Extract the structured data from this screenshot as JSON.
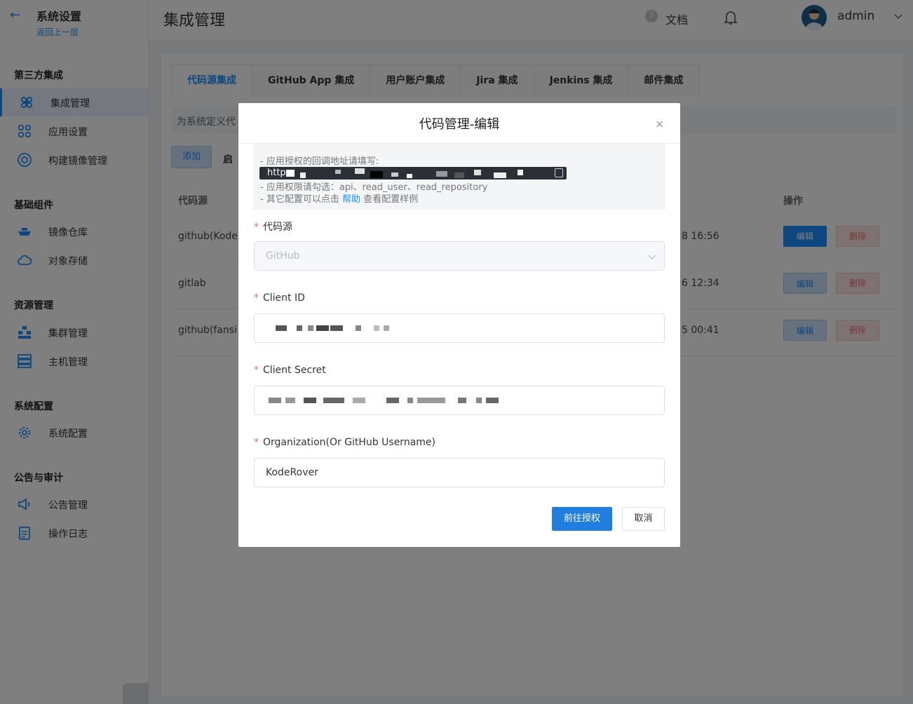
{
  "sidebar": {
    "title": "系统设置",
    "back_label": "返回上一层",
    "groups": [
      {
        "label": "第三方集成"
      },
      {
        "label": "基础组件"
      },
      {
        "label": "资源管理"
      },
      {
        "label": "系统配置"
      },
      {
        "label": "公告与审计"
      }
    ],
    "items": [
      {
        "label": "集成管理",
        "icon": "command-icon",
        "active": true
      },
      {
        "label": "应用设置",
        "icon": "apps-icon"
      },
      {
        "label": "构建镜像管理",
        "icon": "disc-icon"
      },
      {
        "label": "镜像仓库",
        "icon": "ship-icon"
      },
      {
        "label": "对象存储",
        "icon": "cloud-icon"
      },
      {
        "label": "集群管理",
        "icon": "cluster-icon"
      },
      {
        "label": "主机管理",
        "icon": "server-icon"
      },
      {
        "label": "系统配置",
        "icon": "gear-icon"
      },
      {
        "label": "公告管理",
        "icon": "megaphone-icon"
      },
      {
        "label": "操作日志",
        "icon": "clipboard-icon"
      }
    ]
  },
  "header": {
    "title": "集成管理",
    "docs_label": "文档",
    "user_name": "admin"
  },
  "tabs": [
    {
      "label": "代码源集成",
      "active": true
    },
    {
      "label": "GitHub App 集成"
    },
    {
      "label": "用户账户集成"
    },
    {
      "label": "Jira 集成"
    },
    {
      "label": "Jenkins 集成"
    },
    {
      "label": "邮件集成"
    }
  ],
  "main": {
    "info_text": "为系统定义代",
    "add_label": "添加",
    "enable_label": "启",
    "col_source": "代码源",
    "col_actions": "操作",
    "rows": [
      {
        "source": "github(Kode",
        "time": "8 16:56",
        "edit": "编辑",
        "delete": "删除"
      },
      {
        "source": "gitlab",
        "time": "6 12:34",
        "edit": "编辑",
        "delete": "删除"
      },
      {
        "source": "github(fansi",
        "time": "5 00:41",
        "edit": "编辑",
        "delete": "删除"
      }
    ]
  },
  "dialog": {
    "title": "代码管理-编辑",
    "close": "×",
    "notice": {
      "line1": "- 应用授权的回调地址请填写:",
      "url_prefix": "http",
      "line3": "- 应用权限请勾选：api、read_user、read_repository",
      "line4_pre": "- 其它配置可以点击",
      "line4_link": "帮助",
      "line4_post": "查看配置样例"
    },
    "fields": {
      "source_label": "代码源",
      "source_value": "GitHub",
      "client_id_label": "Client ID",
      "client_secret_label": "Client Secret",
      "org_label": "Organization(Or GitHub Username)",
      "org_value": "KodeRover"
    },
    "required_mark": "*",
    "primary_label": "前往授权",
    "cancel_label": "取消"
  },
  "colors": {
    "accent": "#1890ff",
    "danger": "#f56c6c"
  }
}
